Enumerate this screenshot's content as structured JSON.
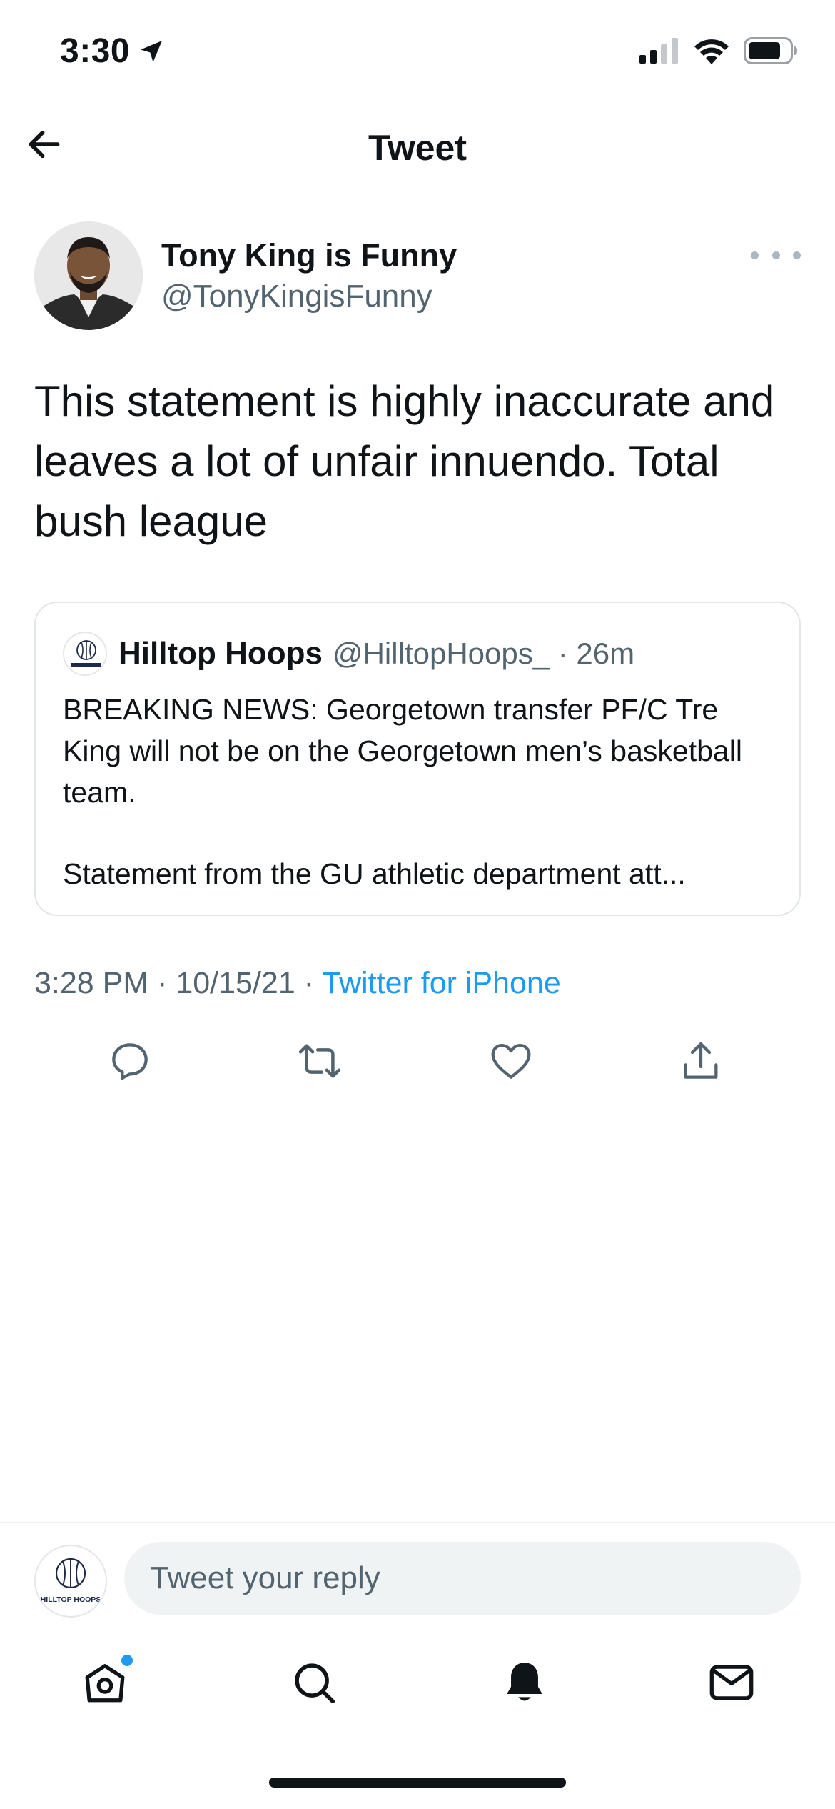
{
  "status_bar": {
    "time": "3:30"
  },
  "header": {
    "title": "Tweet"
  },
  "tweet": {
    "author_name": "Tony King is Funny",
    "author_handle": "@TonyKingisFunny",
    "text": "This statement is highly inaccurate and leaves a lot of unfair innuendo. Total bush league",
    "timestamp": "3:28 PM · 10/15/21 · ",
    "source": "Twitter for iPhone"
  },
  "quote": {
    "name": "Hilltop Hoops",
    "handle": "@HilltopHoops_ · 26m",
    "avatar_text": "HILLTOP HOOPS",
    "body_1": "BREAKING NEWS: Georgetown transfer PF/C Tre King will not be on the Georgetown men’s basketball team.",
    "body_2": "Statement from the GU athletic department att..."
  },
  "reply": {
    "placeholder": "Tweet your reply",
    "avatar_text": "HILLTOP HOOPS"
  },
  "colors": {
    "accent": "#1d9bf0",
    "text": "#0f1419",
    "secondary": "#536471"
  },
  "icons": {
    "status": [
      "location-arrow-icon",
      "cellular-signal-icon",
      "wifi-icon",
      "battery-icon"
    ],
    "actions": [
      "reply-icon",
      "retweet-icon",
      "like-icon",
      "share-icon"
    ],
    "tabs": [
      "home-icon",
      "search-icon",
      "notifications-icon",
      "messages-icon"
    ]
  }
}
